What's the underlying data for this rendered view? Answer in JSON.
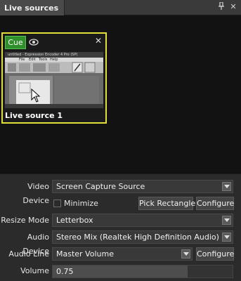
{
  "panel": {
    "title": "Live sources"
  },
  "source": {
    "cue_label": "Cue",
    "name": "Live source 1",
    "thumb_title": "untitled - Expression Encoder 4 Pro (SP)",
    "thumb_menu": [
      "File",
      "Edit",
      "Tools",
      "Help"
    ]
  },
  "properties": {
    "video_device": {
      "label": "Video Device",
      "value": "Screen Capture Source"
    },
    "minimize": {
      "label": "Minimize",
      "checked": false
    },
    "pick_rectangle_label": "Pick Rectangle",
    "configure_label": "Configure",
    "resize_mode": {
      "label": "Resize Mode",
      "value": "Letterbox"
    },
    "audio_device": {
      "label": "Audio Device",
      "value": "Stereo Mix (Realtek High Definition Audio)"
    },
    "audio_line": {
      "label": "Audio Line",
      "value": "Master Volume"
    },
    "audio_configure_label": "Configure",
    "volume": {
      "label": "Volume",
      "value": "0.75",
      "level": 0.75
    }
  },
  "colors": {
    "accent_border": "#e3df3a",
    "cue_green": "#2f8f2a"
  },
  "icons": [
    "pin-icon",
    "close-icon",
    "eye-icon",
    "dropdown-arrow-icon",
    "cursor-icon"
  ]
}
